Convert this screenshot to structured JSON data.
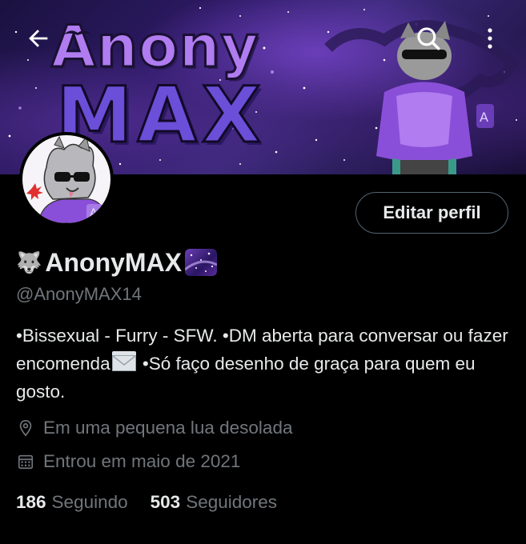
{
  "banner": {
    "title_line1": "Anony",
    "title_line2": "MAX"
  },
  "profile": {
    "display_name": "AnonyMAX",
    "name_prefix_emoji": "🐺",
    "handle": "@AnonyMAX14",
    "edit_label": "Editar perfil",
    "bio_part1": "•Bissexual - Furry - SFW. •DM aberta para conversar ou fazer encomenda",
    "bio_part2": " •Só faço desenho de graça para quem eu gosto.",
    "location": "Em uma pequena lua desolada",
    "joined": "Entrou em maio de 2021",
    "following_count": "186",
    "following_label": "Seguindo",
    "followers_count": "503",
    "followers_label": "Seguidores"
  },
  "icons": {
    "back": "arrow-left-icon",
    "search": "search-icon",
    "more": "more-vertical-icon",
    "location": "location-pin-icon",
    "calendar": "calendar-icon",
    "envelope": "envelope-emoji"
  },
  "colors": {
    "background": "#000000",
    "text_primary": "#e7e9ea",
    "text_secondary": "#71767b",
    "banner_purple": "#6b4fd8"
  }
}
